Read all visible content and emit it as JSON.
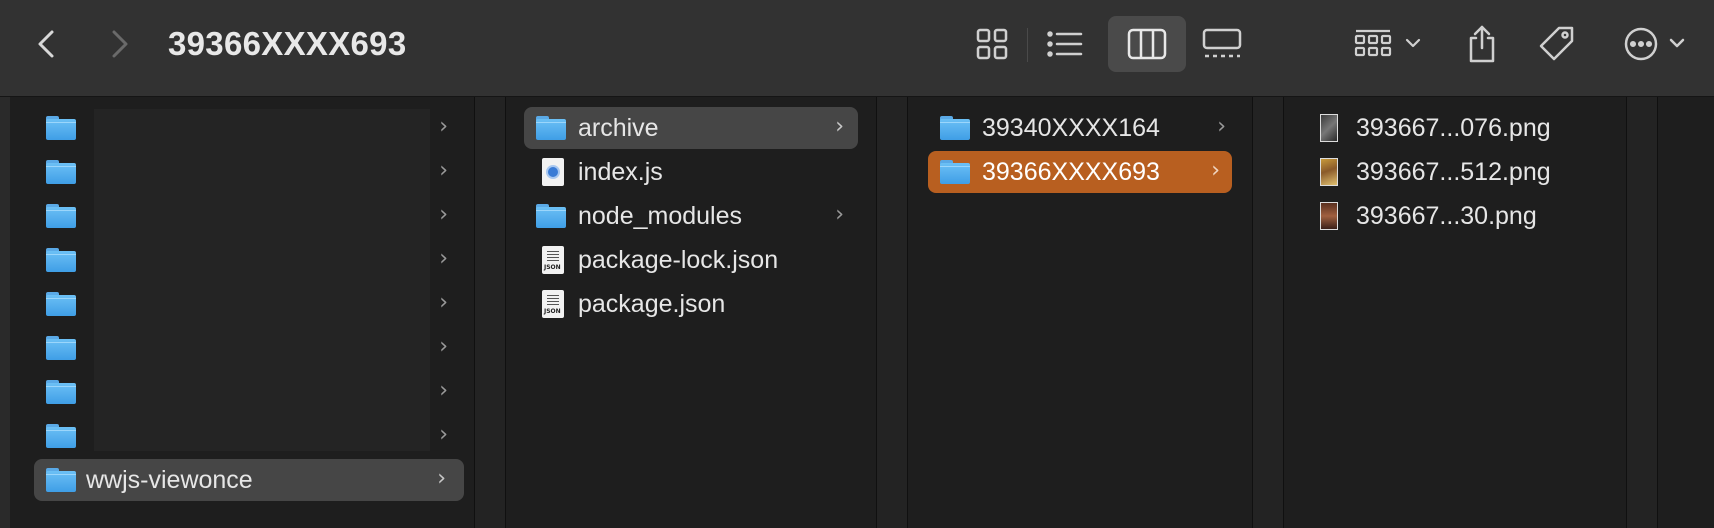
{
  "window": {
    "title": "39366XXXX693"
  },
  "toolbar": {
    "back": "chevron-left-icon",
    "forward": "chevron-right-icon",
    "view_icons": "grid-view-icon",
    "view_list": "list-view-icon",
    "view_columns": "column-view-icon",
    "view_gallery": "gallery-view-icon",
    "group": "group-by-icon",
    "share": "share-icon",
    "tags": "tag-icon",
    "more": "ellipsis-circle-icon",
    "active_view": "columns"
  },
  "columns": {
    "col1": {
      "items": [
        {
          "label": ""
        },
        {
          "label": ""
        },
        {
          "label": ""
        },
        {
          "label": ""
        },
        {
          "label": ""
        },
        {
          "label": ""
        },
        {
          "label": ""
        },
        {
          "label": ""
        },
        {
          "label": "wwjs-viewonce"
        }
      ]
    },
    "col2": {
      "items": [
        {
          "label": "archive",
          "type": "folder"
        },
        {
          "label": "index.js",
          "type": "js"
        },
        {
          "label": "node_modules",
          "type": "folder"
        },
        {
          "label": "package-lock.json",
          "type": "json"
        },
        {
          "label": "package.json",
          "type": "json"
        }
      ]
    },
    "col3": {
      "items": [
        {
          "label": "39340XXXX164",
          "type": "folder"
        },
        {
          "label": "39366XXXX693",
          "type": "folder"
        }
      ]
    },
    "col4": {
      "items": [
        {
          "label": "393667...076.png",
          "type": "image"
        },
        {
          "label": "393667...512.png",
          "type": "image"
        },
        {
          "label": "393667...30.png",
          "type": "image"
        }
      ]
    }
  },
  "colors": {
    "accent_selection": "#b85f20",
    "parent_selection": "#464646",
    "folder": "#4fa8ee"
  }
}
